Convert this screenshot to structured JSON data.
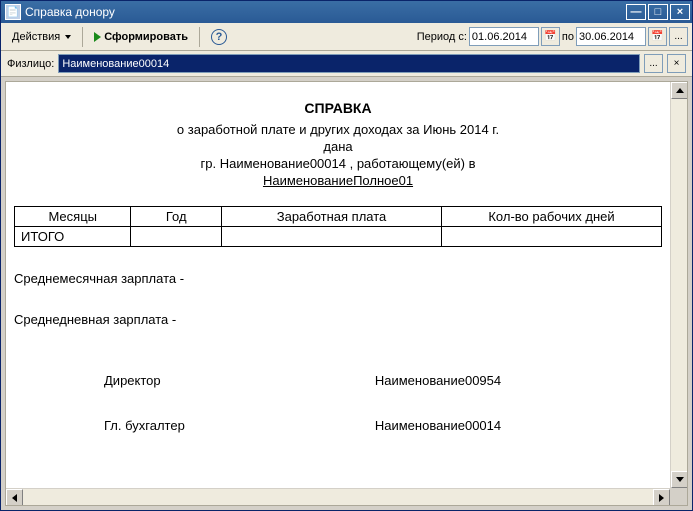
{
  "window": {
    "title": "Справка донору"
  },
  "toolbar": {
    "actions_label": "Действия",
    "generate_label": "Сформировать",
    "period_from_label": "Период с:",
    "date_from": "01.06.2014",
    "period_to_label": "по",
    "date_to": "30.06.2014"
  },
  "filter": {
    "person_label": "Физлицо:",
    "person_value": "Наименование00014"
  },
  "doc": {
    "title": "СПРАВКА",
    "subtitle": "о заработной плате и других доходах  за Июнь 2014 г.",
    "given": "дана",
    "citizen_line": "гр. Наименование00014  , работающему(ей) в",
    "org": "НаименованиеПолное01",
    "columns": {
      "months": "Месяцы",
      "year": "Год",
      "salary": "Заработная  плата",
      "days": "Кол-во рабочих дней"
    },
    "total_row_label": "ИТОГО",
    "avg_month_label": "Среднемесячная зарплата -",
    "avg_day_label": "Среднедневная зарплата -",
    "director_label": "Директор",
    "director_name": "Наименование00954",
    "accountant_label": "Гл. бухгалтер",
    "accountant_name": "Наименование00014"
  }
}
